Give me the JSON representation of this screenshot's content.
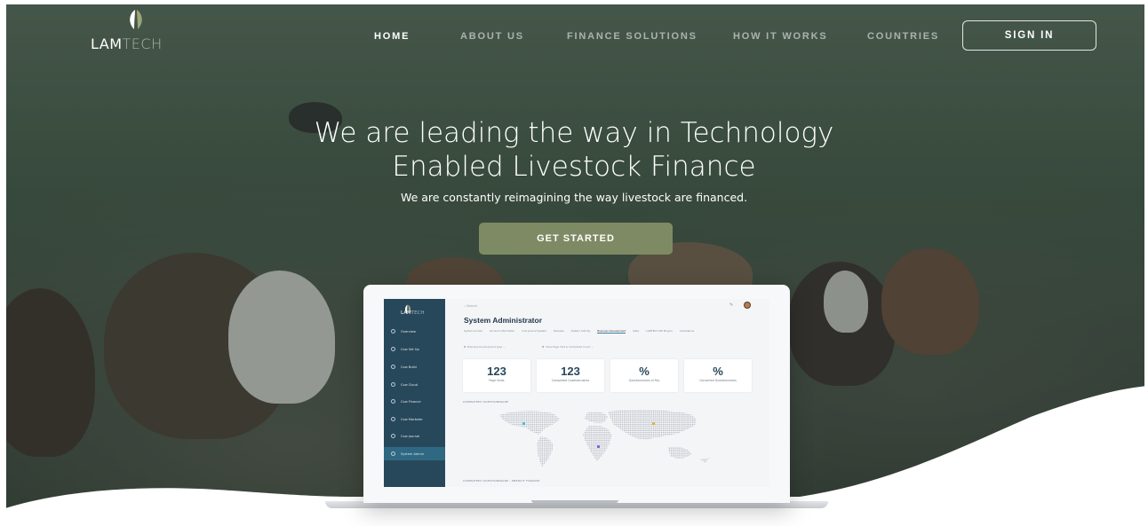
{
  "brand": {
    "logo_main": "LAM",
    "logo_dim": "TECH"
  },
  "nav": {
    "items": [
      {
        "label": "HOME",
        "active": true
      },
      {
        "label": "ABOUT US",
        "active": false
      },
      {
        "label": "FINANCE SOLUTIONS",
        "active": false
      },
      {
        "label": "HOW IT WORKS",
        "active": false
      },
      {
        "label": "COUNTRIES",
        "active": false
      }
    ],
    "signin_label": "SIGN IN"
  },
  "hero": {
    "headline_line1": "We are leading the way in Technology",
    "headline_line2": "Enabled Livestock Finance",
    "subheadline": "We are constantly reimagining the way livestock are financed.",
    "cta_label": "GET STARTED"
  },
  "mockup": {
    "logo_main": "LAM",
    "logo_dim": "TECH",
    "search_placeholder": "Search",
    "title": "System Administrator",
    "sidebar": [
      {
        "label": "Overview",
        "icon": "person-icon"
      },
      {
        "label": "Cow Set Up",
        "icon": "link-icon"
      },
      {
        "label": "Cow Build",
        "icon": "thumb-icon"
      },
      {
        "label": "Cow Cloud",
        "icon": "cloud-icon"
      },
      {
        "label": "Cow Finance",
        "icon": "refresh-icon"
      },
      {
        "label": "Cow Marketer",
        "icon": "circle-icon"
      },
      {
        "label": "Cow Journal",
        "icon": "card-icon"
      },
      {
        "label": "System Admin",
        "icon": "gear-icon",
        "selected": true
      }
    ],
    "tabs": [
      {
        "label": "System Access"
      },
      {
        "label": "Account Information"
      },
      {
        "label": "Cow Journal System"
      },
      {
        "label": "Reviews"
      },
      {
        "label": "System Activity"
      },
      {
        "label": "Business Development",
        "active": true
      },
      {
        "label": "Data"
      },
      {
        "label": "LAMTECH API Plugins"
      },
      {
        "label": "Compliance"
      }
    ],
    "filter1": "Business Development type",
    "filter2": "Show Page Visit & Completed Count",
    "stats": [
      {
        "value": "123",
        "label": "Page Visits"
      },
      {
        "value": "123",
        "label": "Completed Questionnaires"
      },
      {
        "value": "%",
        "label": "Questionnaires of Pay"
      },
      {
        "value": "%",
        "label": "Converted Questionnaires"
      }
    ],
    "section1": "COMPLETED QUESTIONNAIRE",
    "section2": "COMPLETED QUESTIONNAIRE - PREDICT FINANCE"
  },
  "colors": {
    "accent": "#7e8a63",
    "sidebar": "#27485a",
    "sidebar_selected": "#2f6882"
  }
}
